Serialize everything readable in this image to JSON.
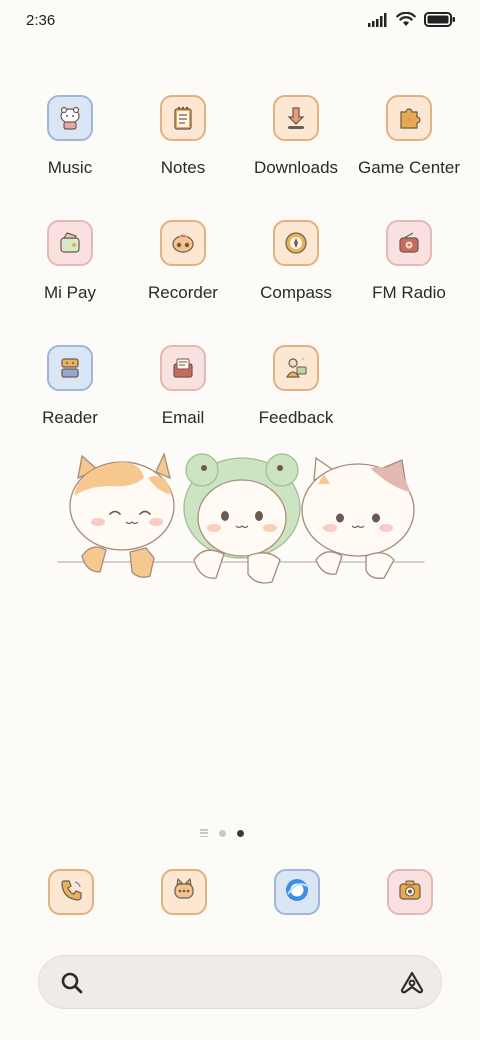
{
  "status_bar": {
    "time": "2:36",
    "icons": [
      "signal-icon",
      "wifi-icon",
      "battery-icon"
    ]
  },
  "apps": [
    {
      "label": "Music",
      "icon": "music-icon",
      "bg": "#dbe6f4",
      "border": "#9fb6d8"
    },
    {
      "label": "Notes",
      "icon": "notes-icon",
      "bg": "#fbe7d2",
      "border": "#e2b17f"
    },
    {
      "label": "Downloads",
      "icon": "downloads-icon",
      "bg": "#fbe7d2",
      "border": "#e2b17f"
    },
    {
      "label": "Game Center",
      "icon": "game-center-icon",
      "bg": "#fbe7d2",
      "border": "#e2b17f"
    },
    {
      "label": "Mi Pay",
      "icon": "mi-pay-icon",
      "bg": "#f9e1e0",
      "border": "#e3b9b6"
    },
    {
      "label": "Recorder",
      "icon": "recorder-icon",
      "bg": "#fbe7d2",
      "border": "#e2b17f"
    },
    {
      "label": "Compass",
      "icon": "compass-icon",
      "bg": "#fbe7d2",
      "border": "#e2b17f"
    },
    {
      "label": "FM Radio",
      "icon": "fm-radio-icon",
      "bg": "#f9e1e0",
      "border": "#e3b9b6"
    },
    {
      "label": "Reader",
      "icon": "reader-icon",
      "bg": "#dbe6f4",
      "border": "#9fb6d8"
    },
    {
      "label": "Email",
      "icon": "email-icon",
      "bg": "#f9e1e0",
      "border": "#e3b9b6"
    },
    {
      "label": "Feedback",
      "icon": "feedback-icon",
      "bg": "#fbe7d2",
      "border": "#e2b17f"
    }
  ],
  "pages": {
    "current": 3,
    "total": 3
  },
  "dock": [
    {
      "icon": "phone-icon",
      "bg": "#fbe7d2",
      "border": "#e2b17f"
    },
    {
      "icon": "messages-icon",
      "bg": "#fbe7d2",
      "border": "#e2b17f"
    },
    {
      "icon": "browser-icon",
      "bg": "#dbe6f4",
      "border": "#9fb6d8"
    },
    {
      "icon": "camera-icon",
      "bg": "#f9e1e0",
      "border": "#e3b9b6"
    }
  ]
}
